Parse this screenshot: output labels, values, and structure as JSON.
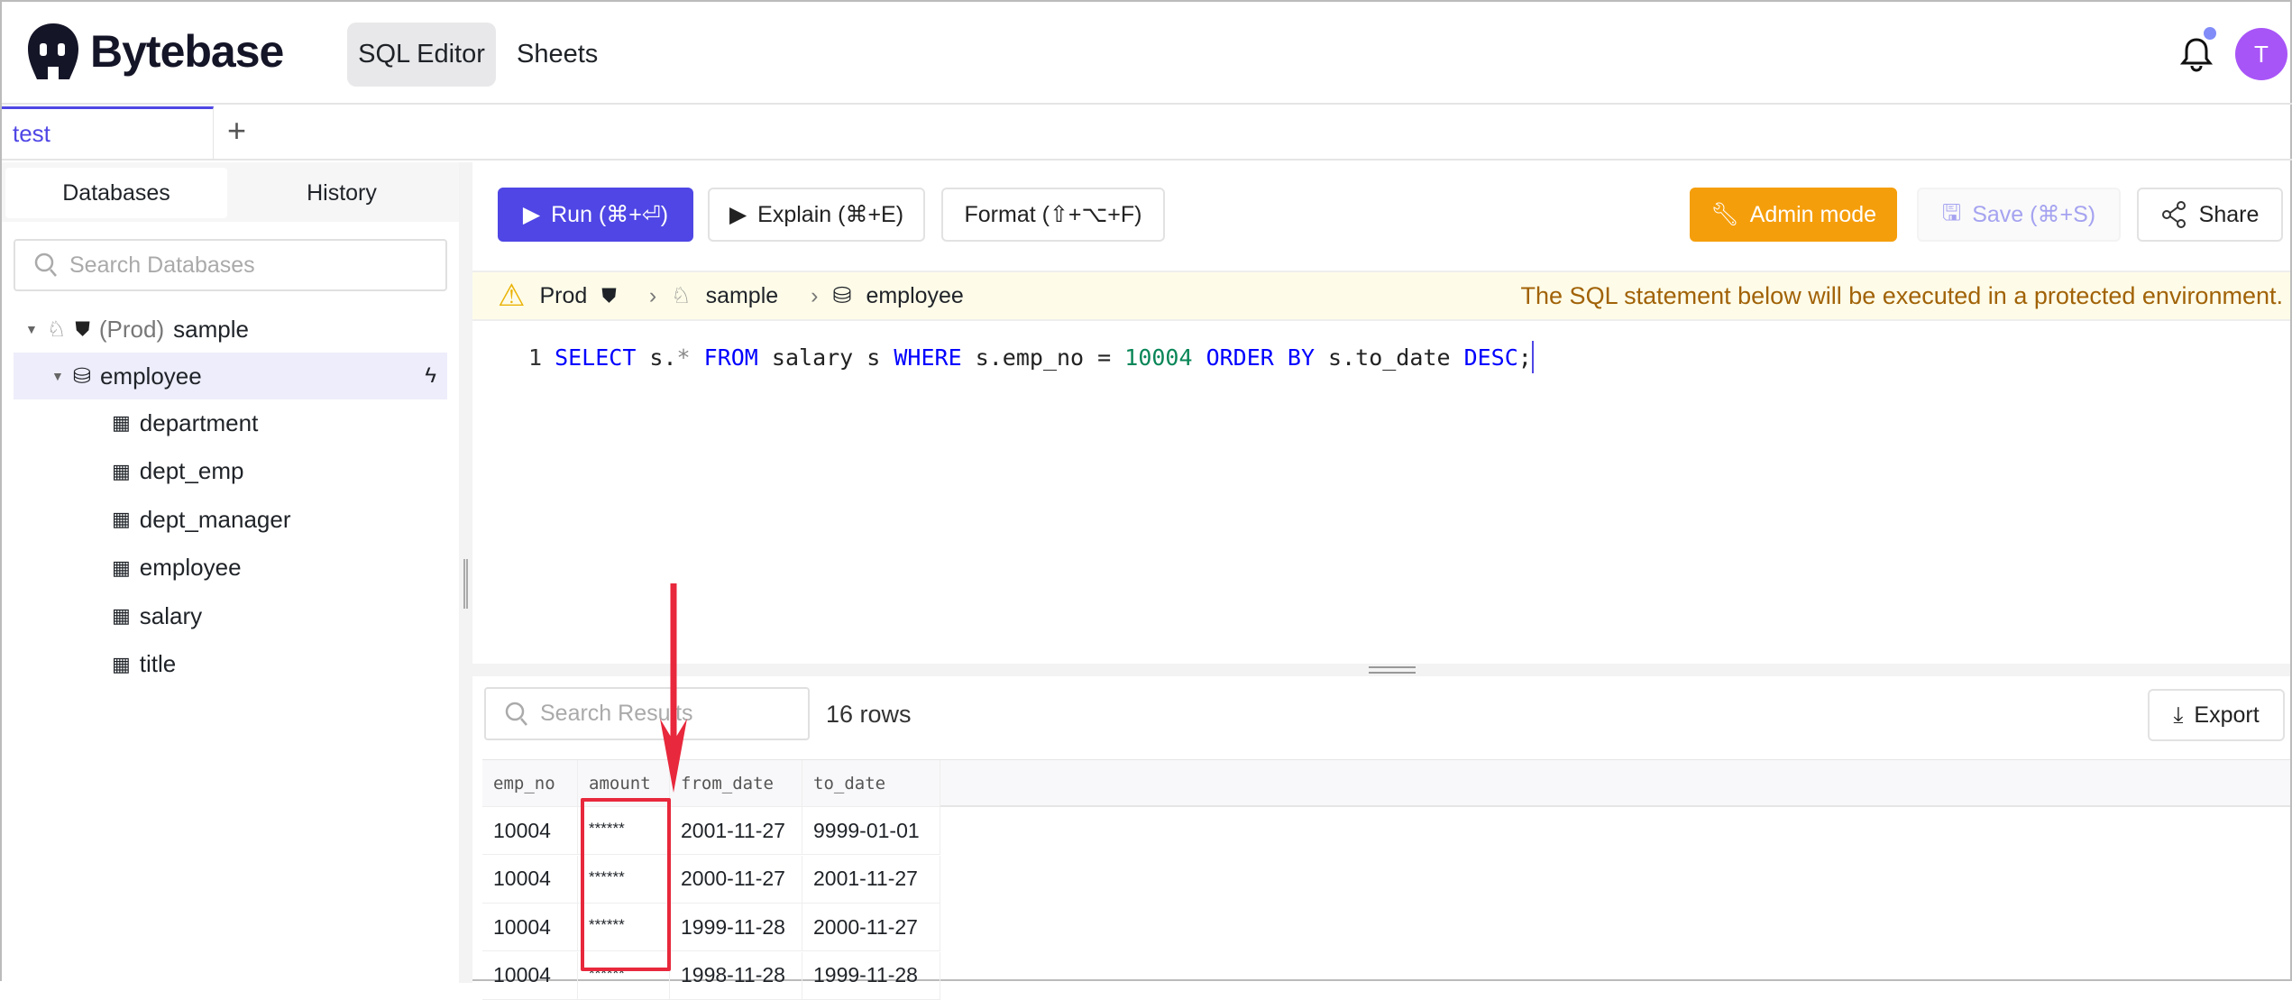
{
  "header": {
    "brand": "Bytebase",
    "nav": [
      {
        "label": "SQL Editor",
        "active": true
      },
      {
        "label": "Sheets"
      }
    ],
    "avatar_initial": "T",
    "accent": "#4f46e5",
    "avatar_color": "#a855f7"
  },
  "tabs": {
    "items": [
      {
        "label": "test"
      }
    ],
    "add_label": "+"
  },
  "sidebar": {
    "tabs": [
      "Databases",
      "History"
    ],
    "search_placeholder": "Search Databases",
    "tree": {
      "instance_env": "(Prod)",
      "instance_name": "sample",
      "database": "employee",
      "tables": [
        "department",
        "dept_emp",
        "dept_manager",
        "employee",
        "salary",
        "title"
      ]
    }
  },
  "toolbar": {
    "run": "Run (⌘+⏎)",
    "explain": "Explain (⌘+E)",
    "format": "Format (⇧+⌥+F)",
    "admin": "Admin mode",
    "save": "Save (⌘+S)",
    "share": "Share"
  },
  "banner": {
    "env": "Prod",
    "instance": "sample",
    "database": "employee",
    "message": "The SQL statement below will be executed in a protected environment."
  },
  "editor": {
    "line_number": "1",
    "tokens": [
      {
        "t": "SELECT",
        "c": "kw"
      },
      {
        "t": " s.",
        "c": "id"
      },
      {
        "t": "*",
        "c": "op"
      },
      {
        "t": " FROM",
        "c": "kw"
      },
      {
        "t": " salary s",
        "c": "id"
      },
      {
        "t": " WHERE",
        "c": "kw"
      },
      {
        "t": " s.emp_no = ",
        "c": "id"
      },
      {
        "t": "10004",
        "c": "num"
      },
      {
        "t": " ORDER BY",
        "c": "kw"
      },
      {
        "t": " s.to_date",
        "c": "id"
      },
      {
        "t": " DESC",
        "c": "kw"
      },
      {
        "t": ";",
        "c": "id"
      }
    ]
  },
  "results": {
    "search_placeholder": "Search Results",
    "row_count": "16 rows",
    "export": "Export",
    "columns": [
      "emp_no",
      "amount",
      "from_date",
      "to_date"
    ],
    "rows": [
      [
        "10004",
        "******",
        "2001-11-27",
        "9999-01-01"
      ],
      [
        "10004",
        "******",
        "2000-11-27",
        "2001-11-27"
      ],
      [
        "10004",
        "******",
        "1999-11-28",
        "2000-11-27"
      ],
      [
        "10004",
        "******",
        "1998-11-28",
        "1999-11-28"
      ]
    ]
  }
}
